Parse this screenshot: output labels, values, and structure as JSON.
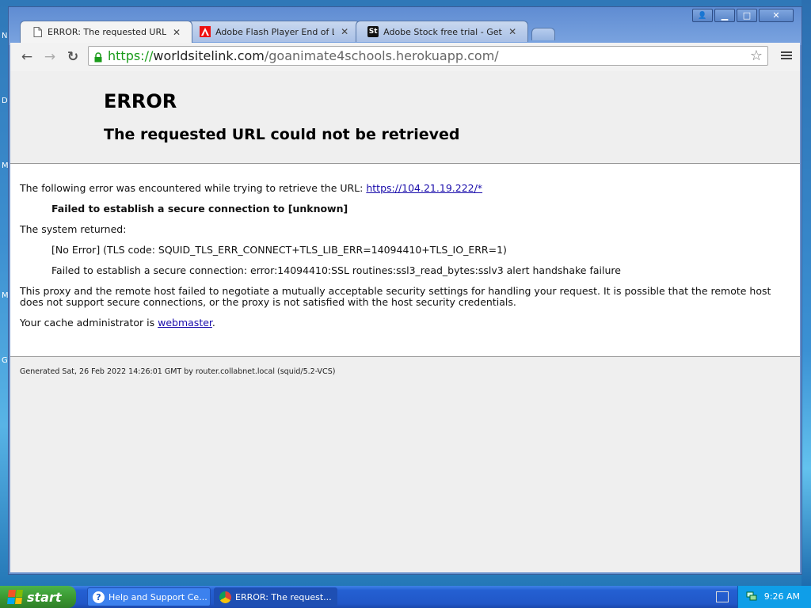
{
  "desktop": {
    "left_letters": [
      "N",
      "D",
      "M",
      "M",
      "G"
    ]
  },
  "tabs": [
    {
      "title": "ERROR: The requested URL",
      "active": true,
      "icon": "page-icon"
    },
    {
      "title": "Adobe Flash Player End of Li",
      "active": false,
      "icon": "adobe-icon"
    },
    {
      "title": "Adobe Stock free trial - Get",
      "active": false,
      "icon": "adobe-stock-icon",
      "icon_text": "St"
    }
  ],
  "toolbar": {
    "back": "←",
    "forward": "→",
    "reload": "↻",
    "url_scheme": "https://",
    "url_host": "worldsitelink.com",
    "url_path": "/goanimate4schools.herokuapp.com/",
    "star": "☆"
  },
  "window_controls": {
    "minimize": "▁",
    "maximize": "□",
    "close": "✕",
    "user": "👤"
  },
  "page": {
    "title": "ERROR",
    "subtitle": "The requested URL could not be retrieved",
    "line1_prefix": "The following error was encountered while trying to retrieve the URL: ",
    "line1_link": "https://104.21.19.222/*",
    "failed": "Failed to establish a secure connection to [unknown]",
    "system_returned": "The system returned:",
    "no_error": "[No Error] (TLS code: SQUID_TLS_ERR_CONNECT+TLS_LIB_ERR=14094410+TLS_IO_ERR=1)",
    "ssl_error": "Failed to establish a secure connection: error:14094410:SSL routines:ssl3_read_bytes:sslv3 alert handshake failure",
    "proxy_line1": "This proxy and the remote host failed to negotiate a mutually acceptable security settings for handling your request. It is possible that the remote host",
    "proxy_line2": "does not support secure connections, or the proxy is not satisfied with the host security credentials.",
    "admin_prefix": "Your cache administrator is ",
    "admin_link": "webmaster",
    "admin_suffix": ".",
    "footer": "Generated Sat, 26 Feb 2022 14:26:01 GMT by router.collabnet.local (squid/5.2-VCS)"
  },
  "taskbar": {
    "start": "start",
    "tasks": [
      {
        "label": "Help and Support Ce...",
        "active": false
      },
      {
        "label": "ERROR: The request...",
        "active": true
      }
    ],
    "clock": "9:26 AM"
  },
  "colors": {
    "link": "#1a0dab",
    "secure_scheme": "#1a9b1a",
    "taskbar": "#2157c8",
    "start": "#3b9a32"
  }
}
